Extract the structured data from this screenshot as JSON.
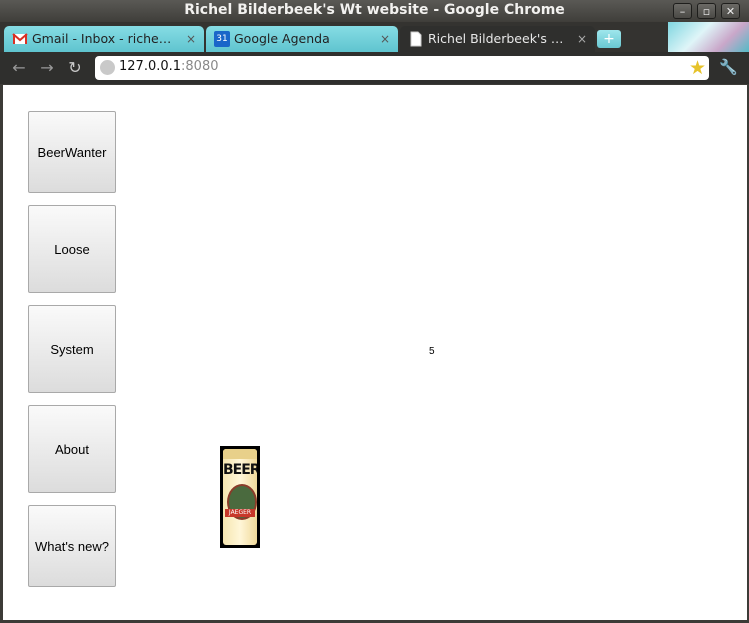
{
  "window": {
    "title": "Richel Bilderbeek's Wt website - Google Chrome",
    "buttons": {
      "minimize": "–",
      "maximize": "▫",
      "close": "✕"
    }
  },
  "tabs": [
    {
      "label": "Gmail - Inbox - richelbild...",
      "icon": "gmail-icon",
      "active": false
    },
    {
      "label": "Google Agenda",
      "icon": "calendar-icon",
      "icon_text": "31",
      "active": false
    },
    {
      "label": "Richel Bilderbeek's Wt ...",
      "icon": "page-icon",
      "active": true
    }
  ],
  "tab_close_glyph": "×",
  "new_tab_glyph": "+",
  "toolbar": {
    "back_glyph": "←",
    "forward_glyph": "→",
    "reload_glyph": "↻",
    "url_host": "127.0.0.1",
    "url_port": ":8080",
    "star_glyph": "★",
    "wrench_glyph": "🔧"
  },
  "menu": {
    "items": [
      "BeerWanter",
      "Loose",
      "System",
      "About",
      "What's new?"
    ]
  },
  "content": {
    "counter": "5",
    "beer_can_text": "BEER",
    "beer_can_label": "JAEGER"
  },
  "colors": {
    "tab_inactive": "#6fd0da",
    "chrome_dark": "#2f2f2d",
    "star": "#e6c22a"
  }
}
